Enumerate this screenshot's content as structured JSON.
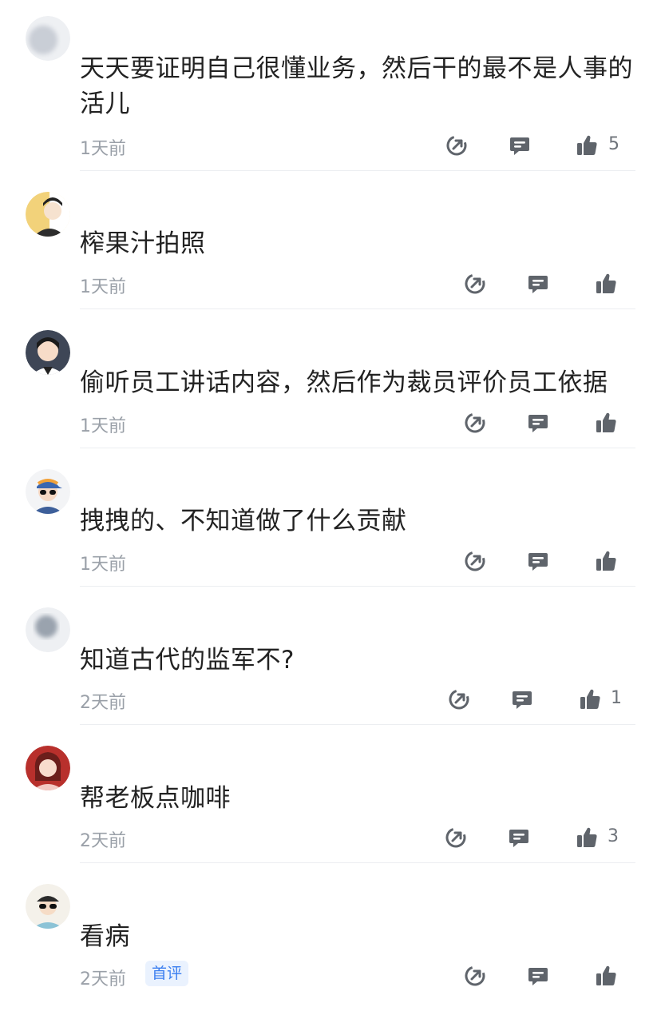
{
  "comments": [
    {
      "username": "",
      "text": "天天要证明自己很懂业务，然后干的最不是人事的活儿",
      "time": "1天前",
      "likes": "5",
      "badge": ""
    },
    {
      "username": "",
      "text": "榨果汁拍照",
      "time": "1天前",
      "likes": "",
      "badge": ""
    },
    {
      "username": "",
      "text": "偷听员工讲话内容，然后作为裁员评价员工依据",
      "time": "1天前",
      "likes": "",
      "badge": ""
    },
    {
      "username": "",
      "text": "拽拽的、不知道做了什么贡献",
      "time": "1天前",
      "likes": "",
      "badge": ""
    },
    {
      "username": "",
      "text": "知道古代的监军不?",
      "time": "2天前",
      "likes": "1",
      "badge": ""
    },
    {
      "username": "",
      "text": "帮老板点咖啡",
      "time": "2天前",
      "likes": "3",
      "badge": ""
    },
    {
      "username": "",
      "text": "看病",
      "time": "2天前",
      "likes": "",
      "badge": "首评"
    }
  ],
  "icons": {
    "share": "share-icon",
    "reply": "comment-bubble-icon",
    "like": "thumbs-up-icon"
  },
  "colors": {
    "text": "#222222",
    "meta": "#9aa0a8",
    "icon": "#5f646b",
    "badge_bg": "#eaf2fe",
    "badge_text": "#3a7ef0"
  }
}
